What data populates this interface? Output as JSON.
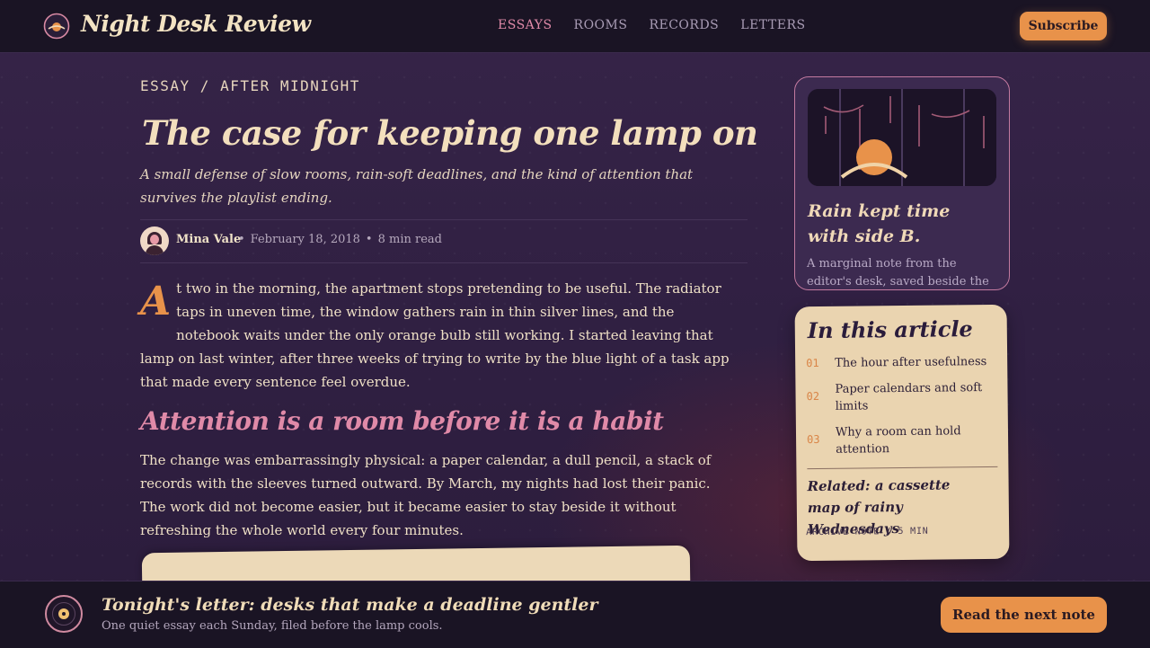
{
  "header": {
    "brand": "Night Desk Review",
    "nav": [
      {
        "label": "ESSAYS",
        "active": true
      },
      {
        "label": "ROOMS",
        "active": false
      },
      {
        "label": "RECORDS",
        "active": false
      },
      {
        "label": "LETTERS",
        "active": false
      }
    ],
    "subscribe_label": "Subscribe",
    "logo_icon": "moon-lamp-icon"
  },
  "article": {
    "kicker": "ESSAY / AFTER MIDNIGHT",
    "title": "The case for keeping one lamp on",
    "dek": "A small defense of slow rooms, rain-soft deadlines, and the kind of attention that survives the playlist ending.",
    "author": "Mina Vale",
    "date": "February 18, 2018",
    "read_time": "8 min read",
    "separator": "•",
    "dropcap": "A",
    "p1": "t two in the morning, the apartment stops pretending to be useful. The radiator taps in uneven time, the window gathers rain in thin silver lines, and the notebook waits under the only orange bulb still working. I started leaving that lamp on last winter, after three weeks of trying to write by the blue light of a task app that made every sentence feel overdue.",
    "h2": "Attention is a room before it is a habit",
    "p2": "The change was embarrassingly physical: a paper calendar, a dull pencil, a stack of records with the sleeves turned outward. By March, my nights had lost their panic. The work did not become easier, but it became easier to stay beside it without refreshing the whole world every four minutes."
  },
  "sidebar": {
    "rain_card": {
      "title": "Rain kept time with side B.",
      "note": "A marginal note from the editor's desk, saved beside the February"
    },
    "toc": {
      "title": "In this article",
      "items": [
        {
          "num": "01",
          "label": "The hour after usefulness"
        },
        {
          "num": "02",
          "label": "Paper calendars and soft limits"
        },
        {
          "num": "03",
          "label": "Why a room can hold attention"
        }
      ],
      "related": "Related: a cassette map of rainy Wednesdays",
      "related_meta": "ARCHIVE NOTE / 5 MIN"
    }
  },
  "footer": {
    "title": "Tonight's letter: desks that make a deadline gentler",
    "subtitle": "One quiet essay each Sunday, filed before the lamp cools.",
    "button_label": "Read the next note",
    "icon": "vinyl-record-icon"
  },
  "colors": {
    "accent_orange": "#e8924a",
    "accent_pink": "#e08aa8",
    "cream": "#ead4b0",
    "background": "#2d1d3e"
  }
}
